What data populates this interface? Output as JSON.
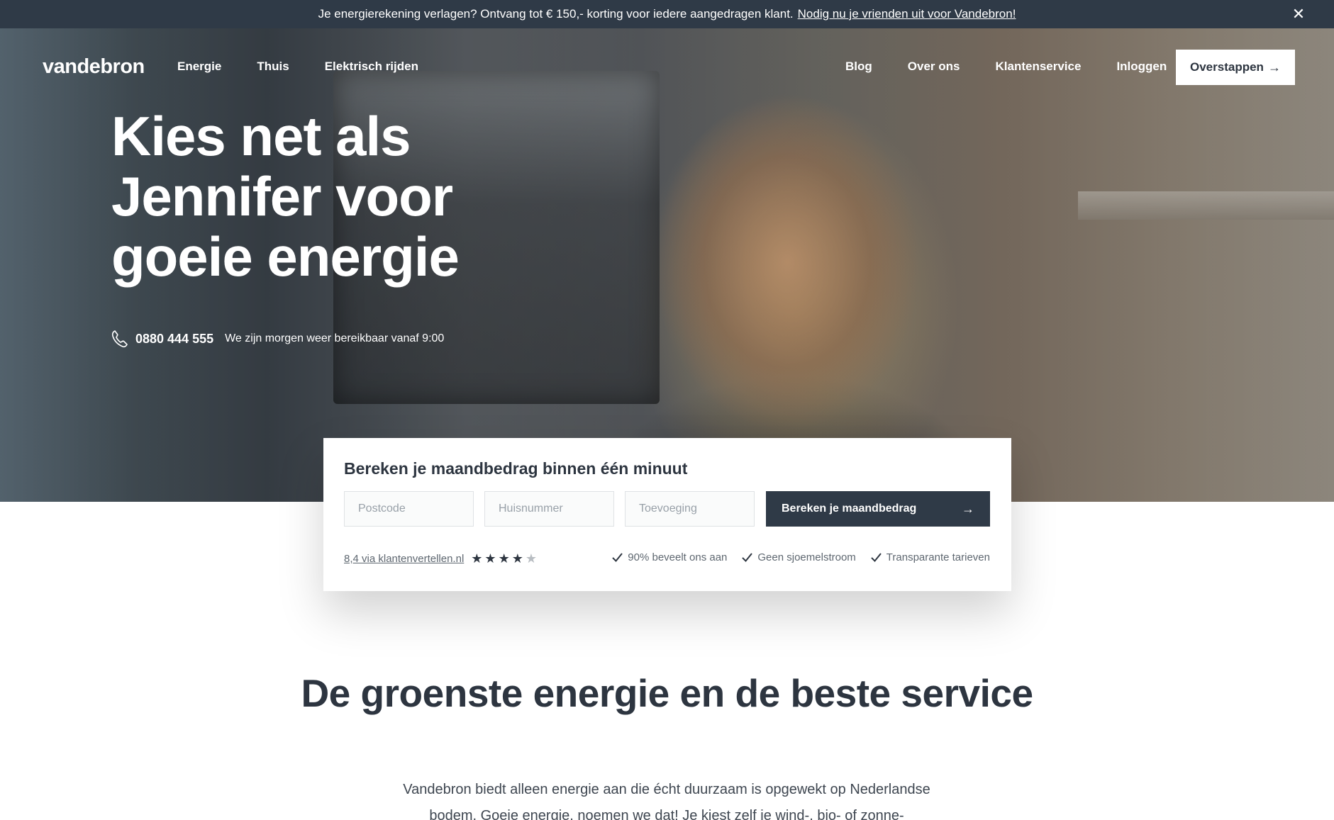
{
  "announcement": {
    "text": "Je energierekening verlagen? Ontvang tot € 150,- korting voor iedere aangedragen klant.",
    "link": "Nodig nu je vrienden uit voor Vandebron!",
    "close": "✕"
  },
  "nav": {
    "logo": "vandebron",
    "left": [
      "Energie",
      "Thuis",
      "Elektrisch rijden"
    ],
    "right": [
      "Blog",
      "Over ons",
      "Klantenservice",
      "Inloggen"
    ],
    "cta": "Overstappen",
    "cta_icon": "arrow-right-icon"
  },
  "hero": {
    "headline": "Kies net als Jennifer voor goeie energie",
    "phone": "0880 444 555",
    "phone_note": "We zijn morgen weer bereikbaar vanaf 9:00",
    "phone_icon": "phone-icon"
  },
  "calculator": {
    "title": "Bereken je maandbedrag binnen één minuut",
    "postcode_placeholder": "Postcode",
    "huisnummer_placeholder": "Huisnummer",
    "toevoeging_placeholder": "Toevoeging",
    "button": "Bereken je maandbedrag",
    "rating_link": "8,4 via klantenvertellen.nl",
    "stars_filled": 4,
    "stars_total": 5,
    "usps": [
      "90% beveelt ons aan",
      "Geen sjoemelstroom",
      "Transparante tarieven"
    ]
  },
  "section": {
    "title": "De groenste energie en de beste service",
    "body": "Vandebron biedt alleen energie aan die écht duurzaam is opgewekt op Nederlandse bodem. Goeie energie, noemen we dat! Je kiest zelf je wind-, bio- of zonne-"
  },
  "colors": {
    "dark": "#2f3a47",
    "text": "#2d3540",
    "white": "#ffffff"
  }
}
